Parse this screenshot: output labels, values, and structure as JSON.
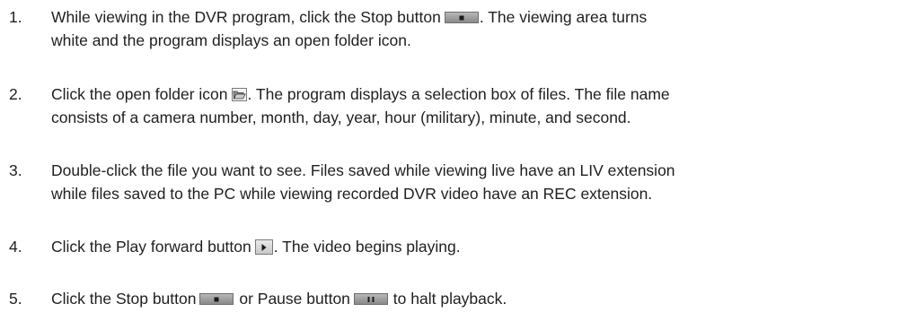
{
  "steps": [
    {
      "number": "1.",
      "segments": [
        "While viewing in the DVR program, click the Stop button",
        ". The viewing area turns",
        "white and the program displays an open folder icon."
      ]
    },
    {
      "number": "2.",
      "segments": [
        "Click the open folder icon",
        ". The program displays a selection box of files. The file name",
        "consists of a camera number, month, day, year, hour (military), minute, and second."
      ]
    },
    {
      "number": "3.",
      "segments": [
        "Double-click the file you want to see. Files saved while viewing live have an LIV extension",
        "while files saved to the PC while viewing recorded DVR video have an REC extension."
      ]
    },
    {
      "number": "4.",
      "segments": [
        "Click the Play forward button",
        ". The video begins playing."
      ]
    },
    {
      "number": "5.",
      "segments": [
        "Click the Stop button",
        "or Pause button",
        "to halt playback."
      ]
    }
  ],
  "icons": {
    "stop": "stop-button-icon",
    "folder": "open-folder-icon",
    "play": "play-forward-button-icon",
    "pause": "pause-button-icon"
  }
}
